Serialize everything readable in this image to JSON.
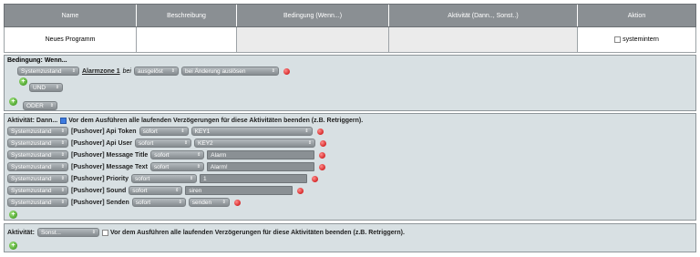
{
  "header": {
    "name": "Name",
    "desc": "Beschreibung",
    "cond": "Bedingung (Wenn...)",
    "act": "Aktivität (Dann.., Sonst..)",
    "action": "Aktion"
  },
  "program": {
    "name": "Neues Programm",
    "systemintern": "systemintern"
  },
  "condition": {
    "title": "Bedingung: Wenn...",
    "sys": "Systemzustand",
    "device": "Alarmzone 1",
    "bei": "bei",
    "state": "ausgelöst",
    "trigger": "bei Änderung auslösen",
    "und": "UND",
    "oder": "ODER"
  },
  "activity": {
    "title": "Aktivität: Dann...",
    "checkbox_text": "Vor dem Ausführen alle laufenden Verzögerungen für diese Aktivitäten beenden (z.B. Retriggern).",
    "rows": [
      {
        "sys": "Systemzustand",
        "label": "[Pushover] Api Token",
        "timing": "sofort",
        "value": "KEY1",
        "kind": "sel"
      },
      {
        "sys": "Systemzustand",
        "label": "[Pushover] Api User",
        "timing": "sofort",
        "value": "KEY2",
        "kind": "sel"
      },
      {
        "sys": "Systemzustand",
        "label": "[Pushover] Message Title",
        "timing": "sofort",
        "value": "Alarm",
        "kind": "txt"
      },
      {
        "sys": "Systemzustand",
        "label": "[Pushover] Message Text",
        "timing": "sofort",
        "value": "Alarm!",
        "kind": "txt"
      },
      {
        "sys": "Systemzustand",
        "label": "[Pushover] Priority",
        "timing": "sofort",
        "value": "1",
        "kind": "txt"
      },
      {
        "sys": "Systemzustand",
        "label": "[Pushover] Sound",
        "timing": "sofort",
        "value": "siren",
        "kind": "txt"
      },
      {
        "sys": "Systemzustand",
        "label": "[Pushover] Senden",
        "timing": "sofort",
        "value": "senden",
        "kind": "sel"
      }
    ]
  },
  "else": {
    "title": "Aktivität:",
    "sonst": "Sonst...",
    "checkbox_text": "Vor dem Ausführen alle laufenden Verzögerungen für diese Aktivitäten beenden (z.B. Retriggern)."
  },
  "icons": {
    "add": "add-icon",
    "delete": "delete-icon",
    "dropdown": "chevron-down-icon"
  }
}
